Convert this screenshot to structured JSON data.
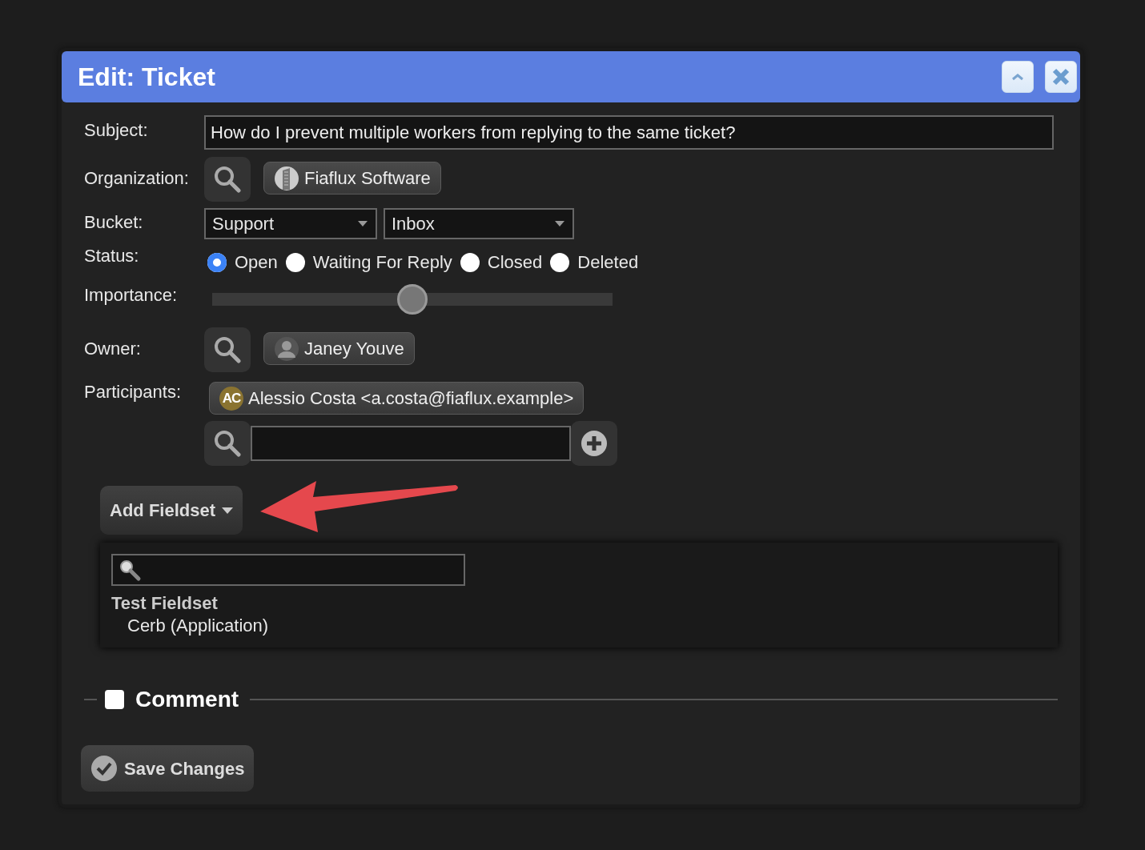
{
  "window": {
    "title": "Edit: Ticket"
  },
  "fields": {
    "subject": {
      "label": "Subject:",
      "value": "How do I prevent multiple workers from replying to the same ticket?"
    },
    "organization": {
      "label": "Organization:",
      "chip": "Fiaflux Software"
    },
    "bucket": {
      "label": "Bucket:",
      "group": "Support",
      "bucket": "Inbox"
    },
    "status": {
      "label": "Status:",
      "options": [
        {
          "label": "Open",
          "selected": true
        },
        {
          "label": "Waiting For Reply",
          "selected": false
        },
        {
          "label": "Closed",
          "selected": false
        },
        {
          "label": "Deleted",
          "selected": false
        }
      ]
    },
    "importance": {
      "label": "Importance:",
      "level": 0.5
    },
    "owner": {
      "label": "Owner:",
      "chip": "Janey Youve"
    },
    "participants": {
      "label": "Participants:",
      "chips": [
        {
          "initials": "AC",
          "text": "Alessio Costa <a.costa@fiaflux.example>"
        }
      ]
    }
  },
  "add_fieldset": {
    "label": "Add Fieldset",
    "menu": {
      "items": [
        {
          "title": "Test Fieldset",
          "subtitle": "Cerb (Application)"
        }
      ]
    }
  },
  "comment": {
    "label": "Comment",
    "checked": false
  },
  "save_button": "Save Changes"
}
